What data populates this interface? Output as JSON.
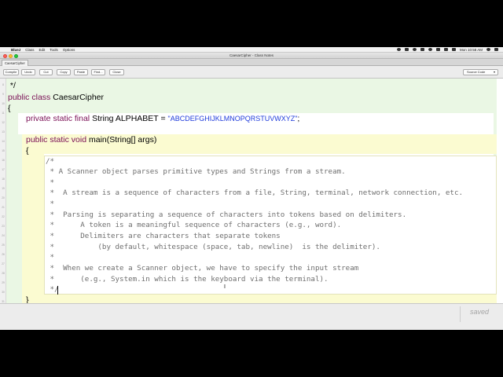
{
  "menubar": {
    "apple_glyph": "",
    "app_name": "BlueJ",
    "menus": [
      "Class",
      "Edit",
      "Tools",
      "Options"
    ],
    "datetime": "Mon 10:58 AM"
  },
  "window": {
    "title": "CaesarCipher - Class Notes"
  },
  "tabs": [
    {
      "label": "CaesarCipher"
    }
  ],
  "toolbar": {
    "buttons": [
      "Compile",
      "Undo",
      "Cut",
      "Copy",
      "Paste",
      "Find...",
      "Close"
    ],
    "view_select": "Source Code",
    "view_caret": "▾"
  },
  "editor": {
    "line_numbers": [
      "8",
      "9",
      "10",
      "11",
      "12",
      "13",
      "14",
      "15",
      "16",
      "17",
      "18",
      "19",
      "20",
      "21",
      "22",
      "23",
      "24",
      "25",
      "26",
      "27",
      "28",
      "29",
      "30",
      "31"
    ],
    "class_comment_end": " */",
    "class_decl": {
      "kw1": "public",
      "kw2": "class",
      "name": "CaesarCipher"
    },
    "open_brace_class": "{",
    "field": {
      "kw1": "private",
      "kw2": "static",
      "kw3": "final",
      "type": "String",
      "name": "ALPHABET",
      "op": "=",
      "value": "\"ABCDEFGHIJKLMNOPQRSTUVWXYZ\"",
      "end": ";"
    },
    "method": {
      "kw1": "public",
      "kw2": "static",
      "kw3": "void",
      "sig": "main(String[] args)"
    },
    "open_brace_method": "{",
    "comment_lines": [
      "/*",
      " * A Scanner object parses primitive types and Strings from a stream.",
      " *",
      " *  A stream is a sequence of characters from a file, String, terminal, network connection, etc.",
      " *",
      " *  Parsing is separating a sequence of characters into tokens based on delimiters.",
      " *      A token is a meaningful sequence of characters (e.g., word).",
      " *      Delimiters are characters that separate tokens",
      " *          (by default, whitespace (space, tab, newline)  is the delimiter).",
      " *",
      " *  When we create a Scanner object, we have to specify the input stream",
      " *      (e.g., System.in which is the keyboard via the terminal).",
      " */"
    ],
    "close_brace_method": "}"
  },
  "status": {
    "text": "saved"
  }
}
